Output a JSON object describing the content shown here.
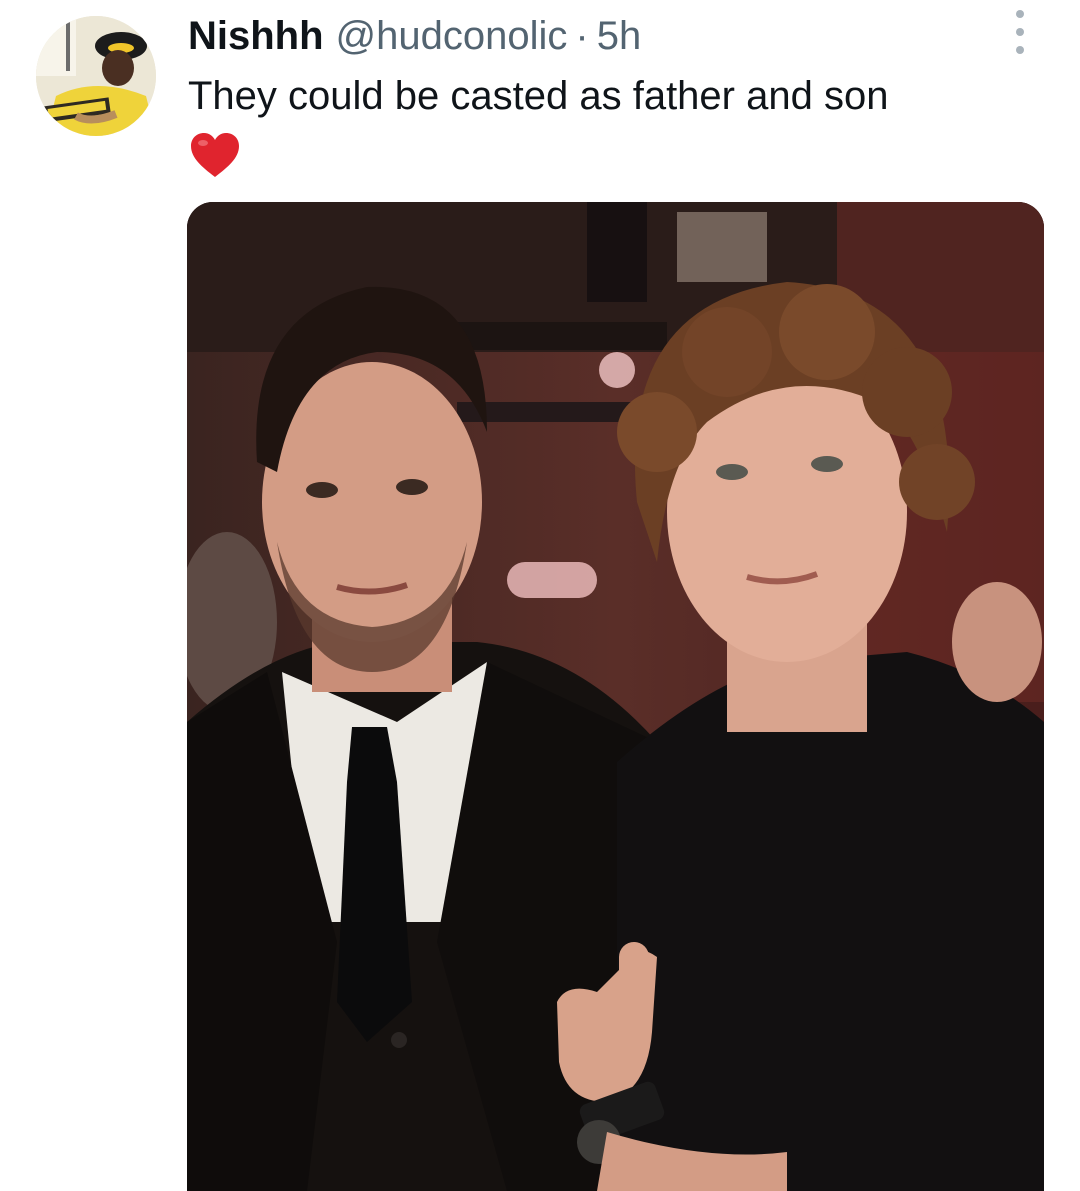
{
  "tweet": {
    "display_name": "Nishhh",
    "handle": "@hudconolic",
    "separator": "·",
    "time": "5h",
    "text": "They could be casted as father and son",
    "emoji": "heart-emoji",
    "more_icon": "more-vertical-icon"
  },
  "colors": {
    "name_text": "#0f1419",
    "meta_text": "#536471",
    "heart": "#e0242e"
  }
}
